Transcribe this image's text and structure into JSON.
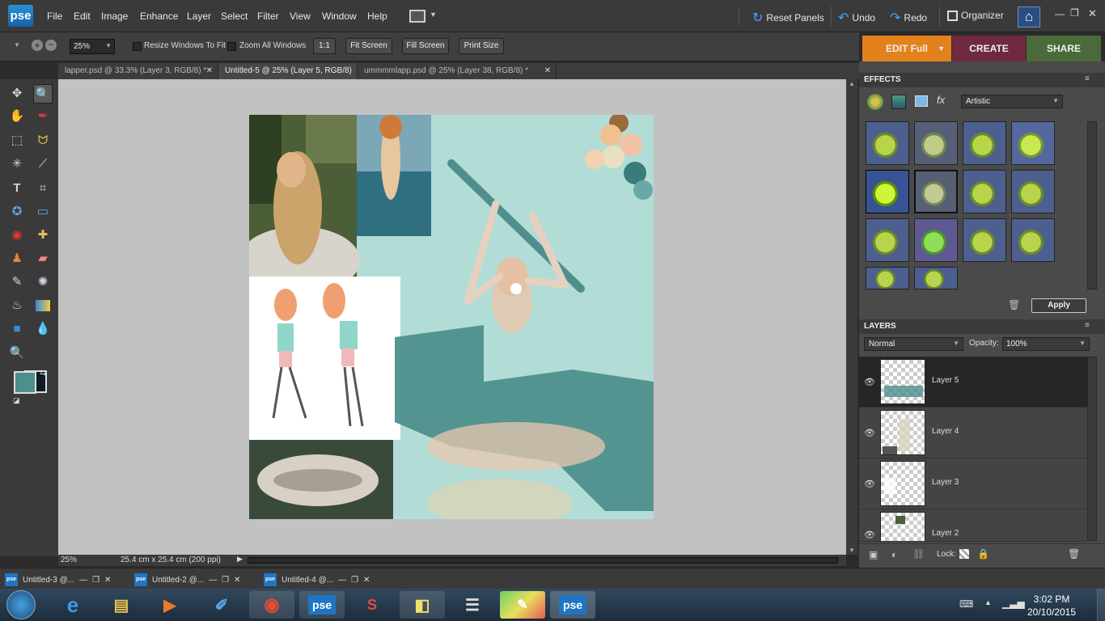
{
  "app": {
    "logo": "pse"
  },
  "menu": [
    "File",
    "Edit",
    "Image",
    "Enhance",
    "Layer",
    "Select",
    "Filter",
    "View",
    "Window",
    "Help"
  ],
  "top_actions": {
    "reset_panels": "Reset Panels",
    "undo": "Undo",
    "redo": "Redo",
    "organizer": "Organizer"
  },
  "options": {
    "zoom": "25%",
    "resize_windows": "Resize Windows To Fit",
    "zoom_all": "Zoom All Windows",
    "one_to_one": "1:1",
    "fit_screen": "Fit Screen",
    "fill_screen": "Fill Screen",
    "print_size": "Print Size"
  },
  "modes": {
    "edit": "EDIT Full",
    "create": "CREATE",
    "share": "SHARE"
  },
  "tabs": [
    {
      "label": "lapper.psd @ 33.3% (Layer 3, RGB/8) *",
      "close": "✕"
    },
    {
      "label": "Untitled-5 @ 25% (Layer 5, RGB/8) *",
      "close": "✕"
    },
    {
      "label": "ummmmlapp.psd @ 25% (Layer 38, RGB/8) *",
      "close": "✕"
    }
  ],
  "status": {
    "zoom": "25%",
    "doc_size": "25.4 cm x 25.4 cm (200 ppi)"
  },
  "effects": {
    "title": "EFFECTS",
    "category": "Artistic",
    "apply": "Apply"
  },
  "layers": {
    "title": "LAYERS",
    "blend": "Normal",
    "opacity_label": "Opacity:",
    "opacity": "100%",
    "lock": "Lock:",
    "items": [
      {
        "name": "Layer 5"
      },
      {
        "name": "Layer 4"
      },
      {
        "name": "Layer 3"
      },
      {
        "name": "Layer 2"
      }
    ]
  },
  "docs": [
    {
      "label": "Untitled-3 @..."
    },
    {
      "label": "Untitled-2 @..."
    },
    {
      "label": "Untitled-4 @..."
    }
  ],
  "taskbar": {
    "time": "3:02 PM",
    "date": "20/10/2015"
  },
  "colors": {
    "foreground": "#4e8f8d",
    "background": "#0f1a27",
    "accent_edit": "#e3811c",
    "accent_create": "#6f2a3f",
    "accent_share": "#4a6b39"
  }
}
